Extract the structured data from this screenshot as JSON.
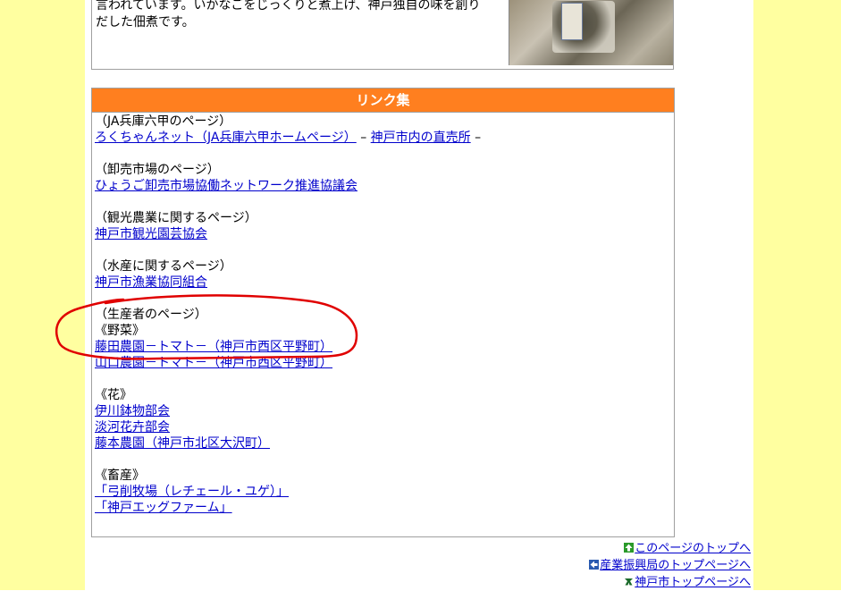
{
  "intro": {
    "line1": "言われています。いかなごをじっくりと煮上げ、神戸独自の味を創り",
    "line2": "だした佃煮です。"
  },
  "links_section": {
    "header": "リンク集",
    "groups": [
      {
        "heading": "（JA兵庫六甲のページ）",
        "link1": "ろくちゃんネット（JA兵庫六甲ホームページ）",
        "sep1": " – ",
        "link2": "神戸市内の直売所",
        "sep2": " –"
      },
      {
        "heading": "（卸売市場のページ）",
        "link1": "ひょうご卸売市場協働ネットワーク推進協議会"
      },
      {
        "heading": "（観光農業に関するページ）",
        "link1": "神戸市観光園芸協会"
      },
      {
        "heading": "（水産に関するページ）",
        "link1": "神戸市漁業協同組合"
      },
      {
        "heading": "（生産者のページ）",
        "sub1": "《野菜》",
        "link1": "藤田農園－トマト－（神戸市西区平野町）",
        "link2": "山口農園－トマト－（神戸市西区平野町）",
        "sub2": "《花》",
        "link3": "伊川鉢物部会",
        "link4": "淡河花卉部会",
        "link5": "藤本農園（神戸市北区大沢町）",
        "sub3": "《畜産》",
        "link6": "「弓削牧場（レチェール・ユゲ）」",
        "link7": "「神戸エッグファーム」"
      }
    ]
  },
  "footer": {
    "page_top": "このページのトップへ",
    "bureau_top": "産業振興局のトップページへ",
    "city_top": "神戸市トップページへ"
  },
  "colors": {
    "side_band": "#ffffa0",
    "header_bg": "#ff7f1f",
    "link": "#0000cc",
    "annotation": "#e00000"
  },
  "icons": [
    "up-arrow-icon",
    "left-arrow-icon",
    "kobe-city-emblem-icon"
  ]
}
